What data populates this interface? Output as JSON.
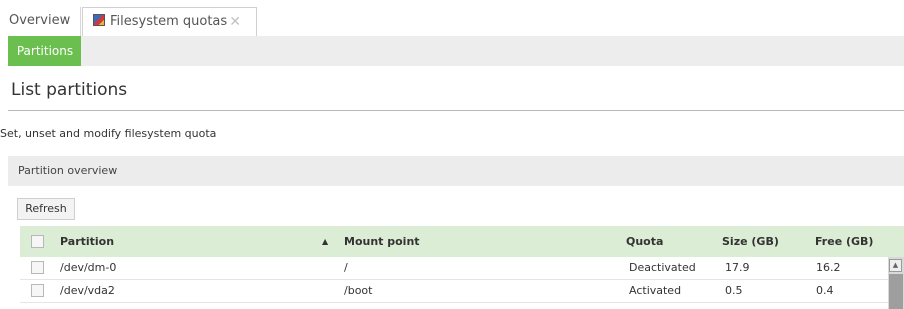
{
  "tabs": {
    "overview": "Overview",
    "quotas": "Filesystem quotas",
    "quotas_icon": "disk-quota-icon",
    "close_icon": "close-icon"
  },
  "subnav": {
    "partitions": "Partitions",
    "accent": "#6bbf4f"
  },
  "page": {
    "title": "List partitions",
    "description": "Set, unset and modify filesystem quota"
  },
  "panel": {
    "title": "Partition overview",
    "refresh_label": "Refresh"
  },
  "table": {
    "header_bg": "#dcedd5",
    "columns": {
      "partition": "Partition",
      "mount": "Mount point",
      "quota": "Quota",
      "size": "Size (GB)",
      "free": "Free (GB)"
    },
    "sort_indicator": "▲",
    "rows": [
      {
        "partition": "/dev/dm-0",
        "mount": "/",
        "quota": "Deactivated",
        "size": "17.9",
        "free": "16.2"
      },
      {
        "partition": "/dev/vda2",
        "mount": "/boot",
        "quota": "Activated",
        "size": "0.5",
        "free": "0.4"
      }
    ]
  }
}
